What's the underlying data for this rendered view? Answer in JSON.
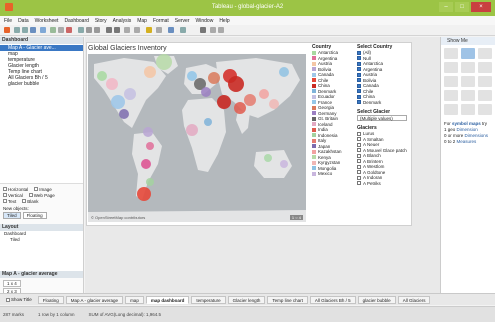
{
  "window": {
    "title": "Tableau - global-glacier-A2"
  },
  "menu": [
    "File",
    "Data",
    "Worksheet",
    "Dashboard",
    "Story",
    "Analysis",
    "Map",
    "Format",
    "Server",
    "Window",
    "Help"
  ],
  "left_panel": {
    "dashboard_header": "Dashboard",
    "sheets": [
      "Map A - Glacier ave...",
      "map",
      "temperature",
      "Glacier length",
      "Temp line chart",
      "All Glaciers Bh / 5",
      "glacier bubble"
    ],
    "options": {
      "horizontal": "Horizontal",
      "image": "Image",
      "vertical": "Vertical",
      "web_page": "Web Page",
      "text": "Text",
      "blank": "Blank"
    },
    "new_objects": "New objects:",
    "tiled": "Tiled",
    "floating": "Floating",
    "layout_header": "Layout",
    "layout_items": [
      "Dashboard",
      "Tiled"
    ],
    "size_header": "Map A - glacier average",
    "size_w": "1 x 4",
    "size_h": "2 x 3"
  },
  "dashboard": {
    "title": "Global Glaciers Inventory"
  },
  "map": {
    "attribution": "© OpenStreetMap contributors",
    "zoom_label": "1 ○ 4"
  },
  "country_filter": {
    "title": "Country",
    "items": [
      "Antarctica",
      "Argentina",
      "Austria",
      "Bolivia",
      "Canada",
      "Chile",
      "China",
      "Denmark",
      "Ecuador",
      "France",
      "Georgia",
      "Germany",
      "Gt. Britain",
      "Iceland",
      "India",
      "Indonesia",
      "Italy",
      "Japan",
      "Kazakhstan",
      "Kenya",
      "Kyrgyzstan",
      "Mongolia",
      "Mexico"
    ]
  },
  "select_country": {
    "title": "Select Country",
    "items": [
      "(All)",
      "Null",
      "Antarctica",
      "Argentina",
      "Austria",
      "Bolivia",
      "Canada",
      "Chile",
      "China",
      "Denmark"
    ]
  },
  "select_glacier": {
    "title": "Select Glacier",
    "value": "(Multiple values)"
  },
  "glaciers": {
    "title": "Glaciers",
    "items": [
      "Lurus",
      "A Smaltan",
      "A Neuer",
      "A Mouvel Glace patch",
      "A Blanch",
      "A Brintern",
      "A Westlom",
      "A Goldtone",
      "A Indoran",
      "A Petriks"
    ]
  },
  "show_me": {
    "title": "Show Me",
    "hint_prefix": "For",
    "hint_bold": "symbol maps",
    "hint_try": "try",
    "hint_lines": [
      "1 geo",
      "0 or more",
      "0 to 2"
    ],
    "hint_dims": [
      "Dimension",
      "Dimensions",
      "Measures"
    ]
  },
  "tabs": {
    "show_title": "Show Title",
    "floating": "Floating",
    "items": [
      "Map A - glacier average",
      "map",
      "map dashboard",
      "temperature",
      "Glacier length",
      "Temp line chart",
      "All Glaciers Bh / 5",
      "glacier bubble",
      "All Glaciers"
    ]
  },
  "status": {
    "marks": "287 marks",
    "rows": "1 row by 1 column",
    "sum": "SUM of AVG(Long decimal): 1,964.5"
  },
  "colors": {
    "titlebar": "#9cc445",
    "accent": "#3a78c4",
    "bubble_red": "#d4312c"
  }
}
